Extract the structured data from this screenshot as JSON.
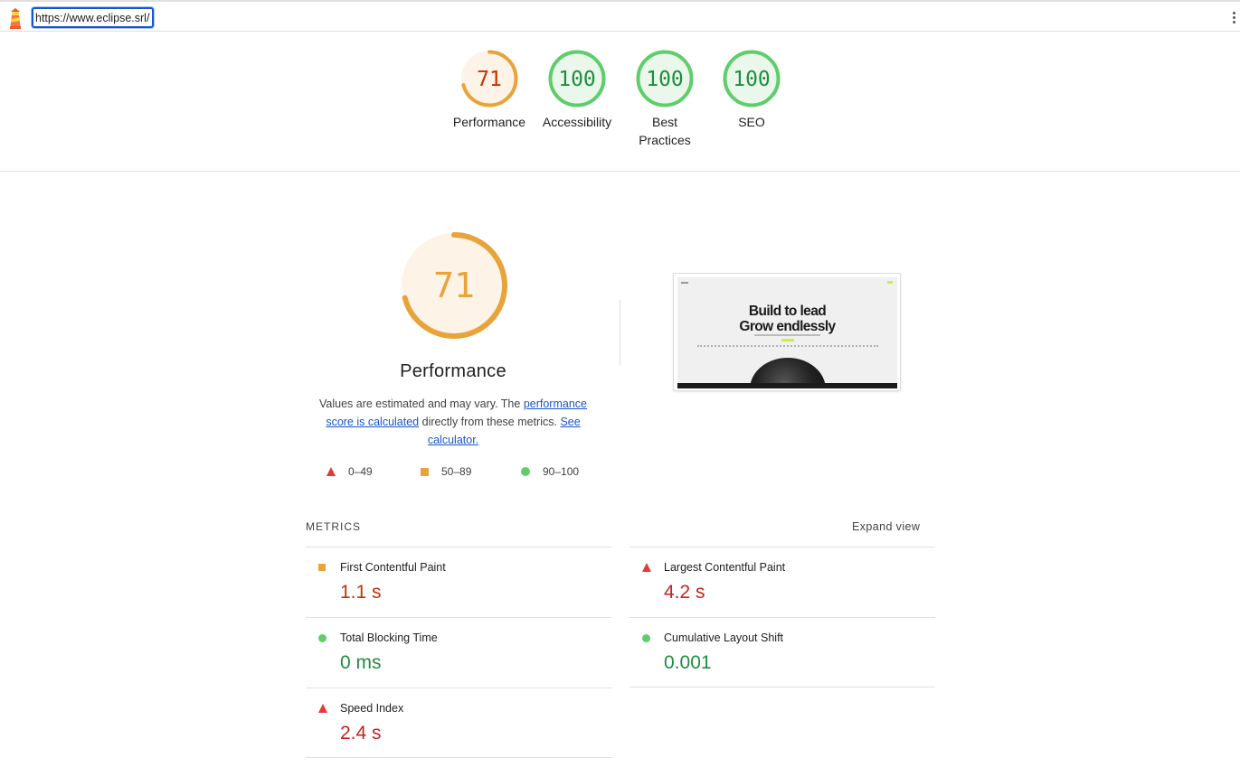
{
  "topbar": {
    "url": "https://www.eclipse.srl/"
  },
  "colors": {
    "fail": "#e53935",
    "average": "#e8a33a",
    "pass": "#5fcd6a",
    "fail_text": "#c5221f",
    "average_text": "#c33300",
    "pass_text": "#1e8e3e",
    "link": "#1a56c8"
  },
  "gauges": [
    {
      "label": "Performance",
      "score": "71",
      "status": "average"
    },
    {
      "label": "Accessibility",
      "score": "100",
      "status": "pass"
    },
    {
      "label": "Best Practices",
      "score": "100",
      "status": "pass"
    },
    {
      "label": "SEO",
      "score": "100",
      "status": "pass"
    }
  ],
  "performance": {
    "score": "71",
    "title": "Performance",
    "desc_prefix": "Values are estimated and may vary. The ",
    "desc_link1": "performance score is calculated",
    "desc_middle": " directly from these metrics. ",
    "desc_link2": "See calculator.",
    "legend": [
      {
        "icon": "red-triangle-icon",
        "range": "0–49"
      },
      {
        "icon": "orange-square-icon",
        "range": "50–89"
      },
      {
        "icon": "green-circle-icon",
        "range": "90–100"
      }
    ]
  },
  "thumbnail": {
    "headline_line1": "Build to lead",
    "headline_line2": "Grow endlessly"
  },
  "metrics": {
    "title": "METRICS",
    "expand_label": "Expand view",
    "items": [
      {
        "name": "First Contentful Paint",
        "value": "1.1 s",
        "status": "average",
        "icon": "orange-square-icon"
      },
      {
        "name": "Largest Contentful Paint",
        "value": "4.2 s",
        "status": "fail",
        "icon": "red-triangle-icon"
      },
      {
        "name": "Total Blocking Time",
        "value": "0 ms",
        "status": "pass",
        "icon": "green-circle-icon"
      },
      {
        "name": "Cumulative Layout Shift",
        "value": "0.001",
        "status": "pass",
        "icon": "green-circle-icon"
      },
      {
        "name": "Speed Index",
        "value": "2.4 s",
        "status": "fail",
        "icon": "red-triangle-icon"
      }
    ]
  }
}
